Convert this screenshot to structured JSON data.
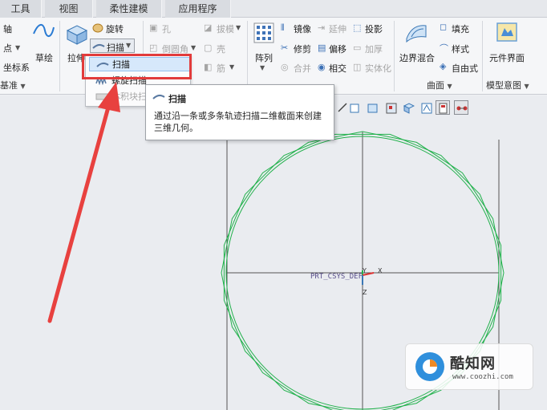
{
  "tabs": [
    {
      "label": "工具"
    },
    {
      "label": "视图"
    },
    {
      "label": "柔性建模"
    },
    {
      "label": "应用程序"
    }
  ],
  "datum_group": {
    "axis": "轴",
    "point": "点",
    "csys": "坐标系",
    "sketch": "草绘",
    "label": "基准"
  },
  "shapes_group": {
    "extrude": "拉伸",
    "revolve": "旋转",
    "sweep": "扫描"
  },
  "engineering_group": {
    "hole": "孔",
    "round": "倒圆角",
    "draft": "拔模",
    "shell": "壳",
    "rib": "筋"
  },
  "editing_group": {
    "pattern": "阵列",
    "mirror": "镜像",
    "trim": "修剪",
    "merge": "合并",
    "extend": "延伸",
    "offset": "偏移",
    "intersect": "相交",
    "project": "投影",
    "thicken": "加厚",
    "solidify": "实体化"
  },
  "surfaces_group": {
    "boundary_blend": "边界混合",
    "fill": "填充",
    "style": "样式",
    "freestyle": "自由式",
    "label": "曲面"
  },
  "model_intent_group": {
    "component_interface": "元件界面",
    "label": "模型意图"
  },
  "sweep_menu": {
    "items": [
      {
        "label": "扫描"
      },
      {
        "label": "螺旋扫描"
      },
      {
        "label": "体积块扫描"
      }
    ]
  },
  "tooltip": {
    "title": "扫描",
    "description": "通过沿一条或多条轨迹扫描二维截面来创建三维几何。"
  },
  "model": {
    "csys_label": "PRT_CSYS_DEF",
    "axis_y": "Y",
    "axis_x": "X",
    "axis_z": "Z"
  },
  "watermark": {
    "name": "酷知网",
    "url": "www.coozhi.com"
  },
  "colors": {
    "geometry": "#22b14c",
    "highlight_box": "#e23b3b",
    "arrow": "#e8413f"
  }
}
